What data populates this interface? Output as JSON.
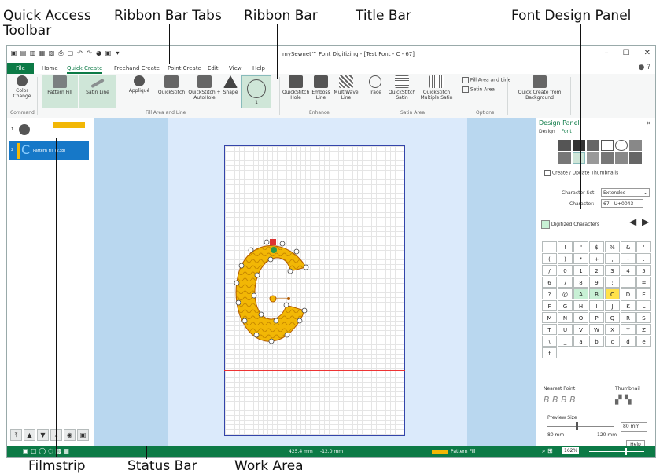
{
  "callouts": {
    "quick_access_toolbar": "Quick Access Toolbar",
    "ribbon_bar_tabs": "Ribbon Bar Tabs",
    "ribbon_bar": "Ribbon Bar",
    "title_bar": "Title Bar",
    "font_design_panel": "Font Design Panel",
    "filmstrip": "Filmstrip",
    "status_bar": "Status Bar",
    "work_area": "Work Area"
  },
  "window": {
    "title": "mySewnet™ Font Digitizing - [Test Font - C - 67]",
    "controls": [
      "–",
      "☐",
      "✕"
    ]
  },
  "tabs": {
    "file": "File",
    "items": [
      "Home",
      "Quick Create",
      "Freehand Create",
      "Point Create",
      "Edit",
      "View",
      "Help"
    ],
    "active": "Quick Create"
  },
  "ribbon": {
    "buttons": {
      "color_change": "Color Change",
      "pattern_fill": "Pattern Fill",
      "satin_line": "Satin Line",
      "applique": "Appliqué",
      "quickstitch": "QuickStitch",
      "quickstitch_autohole": "QuickStitch + AutoHole",
      "shape": "Shape",
      "shape_value": "1",
      "quickstitch_hole": "QuickStitch Hole",
      "emboss_line": "Emboss Line",
      "multiwave_line": "MultiWave Line",
      "trace": "Trace",
      "quickstitch_satin": "QuickStitch Satin",
      "quickstitch_multiple_satin": "QuickStitch Multiple Satin",
      "fill_area_and_line": "Fill Area and Line",
      "satin_area": "Satin Area",
      "quick_create_from_background": "Quick Create from Background"
    },
    "groups": {
      "command": "Command",
      "fill_area_and_line": "Fill Area and Line",
      "enhance": "Enhance",
      "satin_area": "Satin Area",
      "options": "Options"
    }
  },
  "filmstrip": {
    "rows": [
      {
        "num": "1",
        "label": ""
      },
      {
        "num": "2",
        "label": "Pattern Fill (238)"
      }
    ]
  },
  "panel": {
    "title": "Design Panel",
    "close": "×",
    "tabs": [
      "Design",
      "Font"
    ],
    "create_thumbnails": "Create / Update Thumbnails",
    "character_set_label": "Character Set:",
    "character_set_value": "Extended",
    "character_label": "Character:",
    "character_value": "67 - U+0043",
    "digitized_characters": "Digitized Characters",
    "chars": [
      " ",
      "!",
      "\"",
      "$",
      "%",
      "&",
      "'",
      "(",
      ")",
      "*",
      "+",
      ",",
      "-",
      ".",
      "/",
      "0",
      "1",
      "2",
      "3",
      "4",
      "5",
      "6",
      "7",
      "8",
      "9",
      ":",
      ";",
      "=",
      "?",
      "@",
      "A",
      "B",
      "C",
      "D",
      "E",
      "F",
      "G",
      "H",
      "I",
      "J",
      "K",
      "L",
      "M",
      "N",
      "O",
      "P",
      "Q",
      "R",
      "S",
      "T",
      "U",
      "V",
      "W",
      "X",
      "Y",
      "Z",
      "\\",
      "_",
      "a",
      "b",
      "c",
      "d",
      "e",
      "f"
    ],
    "digitized": [
      "A",
      "B",
      "C"
    ],
    "current": "C",
    "nearest_point": "Nearest Point",
    "thumbnail": "Thumbnail",
    "preview_size": "Preview Size",
    "preview_value": "80 mm",
    "preview_min": "80 mm",
    "preview_max": "120 mm",
    "help": "Help"
  },
  "statusbar": {
    "x": "425.4 mm",
    "y": "-12.0 mm",
    "stitch_type": "Pattern Fill",
    "zoom": "162%"
  },
  "colors": {
    "accent": "#0c7a46",
    "fill": "#f2b705",
    "hoop_border": "#3344aa"
  }
}
